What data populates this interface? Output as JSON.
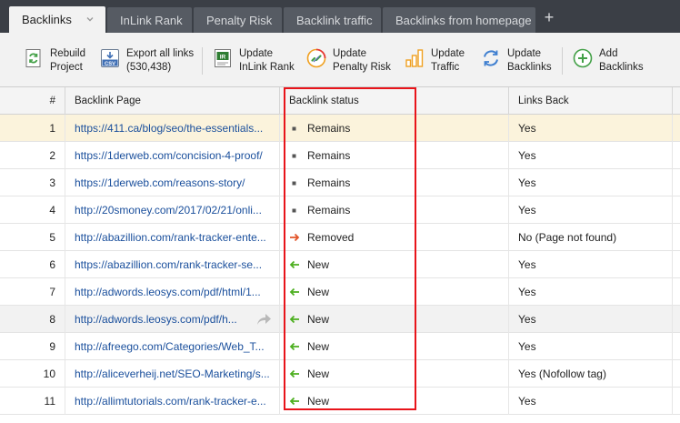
{
  "tabs": [
    {
      "label": "Backlinks",
      "active": true
    },
    {
      "label": "InLink Rank",
      "active": false
    },
    {
      "label": "Penalty Risk",
      "active": false
    },
    {
      "label": "Backlink traffic",
      "active": false
    },
    {
      "label": "Backlinks from homepage",
      "active": false
    }
  ],
  "toolbar": {
    "rebuild": "Rebuild\nProject",
    "export": "Export all links\n(530,438)",
    "export_badge": "CSV",
    "update_inlink": "Update\nInLink Rank",
    "inlink_badge": "IR",
    "update_penalty": "Update\nPenalty Risk",
    "update_traffic": "Update\nTraffic",
    "update_backlinks": "Update\nBacklinks",
    "add_backlinks": "Add\nBacklinks"
  },
  "table": {
    "columns": {
      "num": "#",
      "page": "Backlink Page",
      "status": "Backlink status",
      "links_back": "Links Back"
    },
    "rows": [
      {
        "num": "1",
        "url": "https://411.ca/blog/seo/the-essentials...",
        "status": "Remains",
        "status_icon": "square-bullet-icon",
        "links_back": "Yes"
      },
      {
        "num": "2",
        "url": "https://1derweb.com/concision-4-proof/",
        "status": "Remains",
        "status_icon": "square-bullet-icon",
        "links_back": "Yes"
      },
      {
        "num": "3",
        "url": "https://1derweb.com/reasons-story/",
        "status": "Remains",
        "status_icon": "square-bullet-icon",
        "links_back": "Yes"
      },
      {
        "num": "4",
        "url": "http://20smoney.com/2017/02/21/onli...",
        "status": "Remains",
        "status_icon": "square-bullet-icon",
        "links_back": "Yes"
      },
      {
        "num": "5",
        "url": "http://abazillion.com/rank-tracker-ente...",
        "status": "Removed",
        "status_icon": "arrow-right-icon",
        "links_back": "No (Page not found)"
      },
      {
        "num": "6",
        "url": "https://abazillion.com/rank-tracker-se...",
        "status": "New",
        "status_icon": "arrow-left-icon",
        "links_back": "Yes"
      },
      {
        "num": "7",
        "url": "http://adwords.leosys.com/pdf/html/1...",
        "status": "New",
        "status_icon": "arrow-left-icon",
        "links_back": "Yes"
      },
      {
        "num": "8",
        "url": "http://adwords.leosys.com/pdf/h...",
        "status": "New",
        "status_icon": "arrow-left-icon",
        "links_back": "Yes"
      },
      {
        "num": "9",
        "url": "http://afreego.com/Categories/Web_T...",
        "status": "New",
        "status_icon": "arrow-left-icon",
        "links_back": "Yes"
      },
      {
        "num": "10",
        "url": "http://aliceverheij.net/SEO-Marketing/s...",
        "status": "New",
        "status_icon": "arrow-left-icon",
        "links_back": "Yes (Nofollow tag)"
      },
      {
        "num": "11",
        "url": "http://allimtutorials.com/rank-tracker-e...",
        "status": "New",
        "status_icon": "arrow-left-icon",
        "links_back": "Yes"
      }
    ]
  },
  "colors": {
    "remains": "#555555",
    "removed": "#e2552a",
    "new": "#4caf1f",
    "link": "#1a4f9c",
    "highlight": "#e8141a"
  }
}
